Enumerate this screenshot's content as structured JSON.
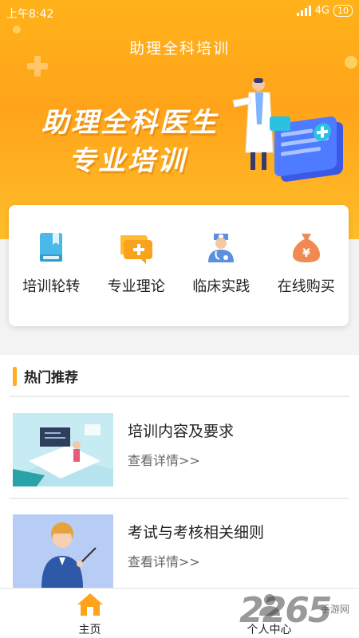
{
  "status_bar": {
    "time": "上午8:42",
    "network": "4G",
    "battery": "10"
  },
  "header": {
    "title": "助理全科培训"
  },
  "banner": {
    "line1": "助理全科医生",
    "line2": "专业培训"
  },
  "menu": [
    {
      "label": "培训轮转",
      "icon": "book-icon"
    },
    {
      "label": "专业理论",
      "icon": "message-plus-icon"
    },
    {
      "label": "临床实践",
      "icon": "doctor-icon"
    },
    {
      "label": "在线购买",
      "icon": "money-bag-icon"
    }
  ],
  "recommend": {
    "title": "热门推荐",
    "items": [
      {
        "title": "培训内容及要求",
        "link": "查看详情>>"
      },
      {
        "title": "考试与考核相关细则",
        "link": "查看详情>>"
      }
    ]
  },
  "tabbar": {
    "home_label": "主页",
    "profile_label": "个人中心"
  },
  "watermark": {
    "text": "2265",
    "sub": "手游网"
  },
  "colors": {
    "accent": "#ffae1c",
    "hero": "#ffb219"
  }
}
